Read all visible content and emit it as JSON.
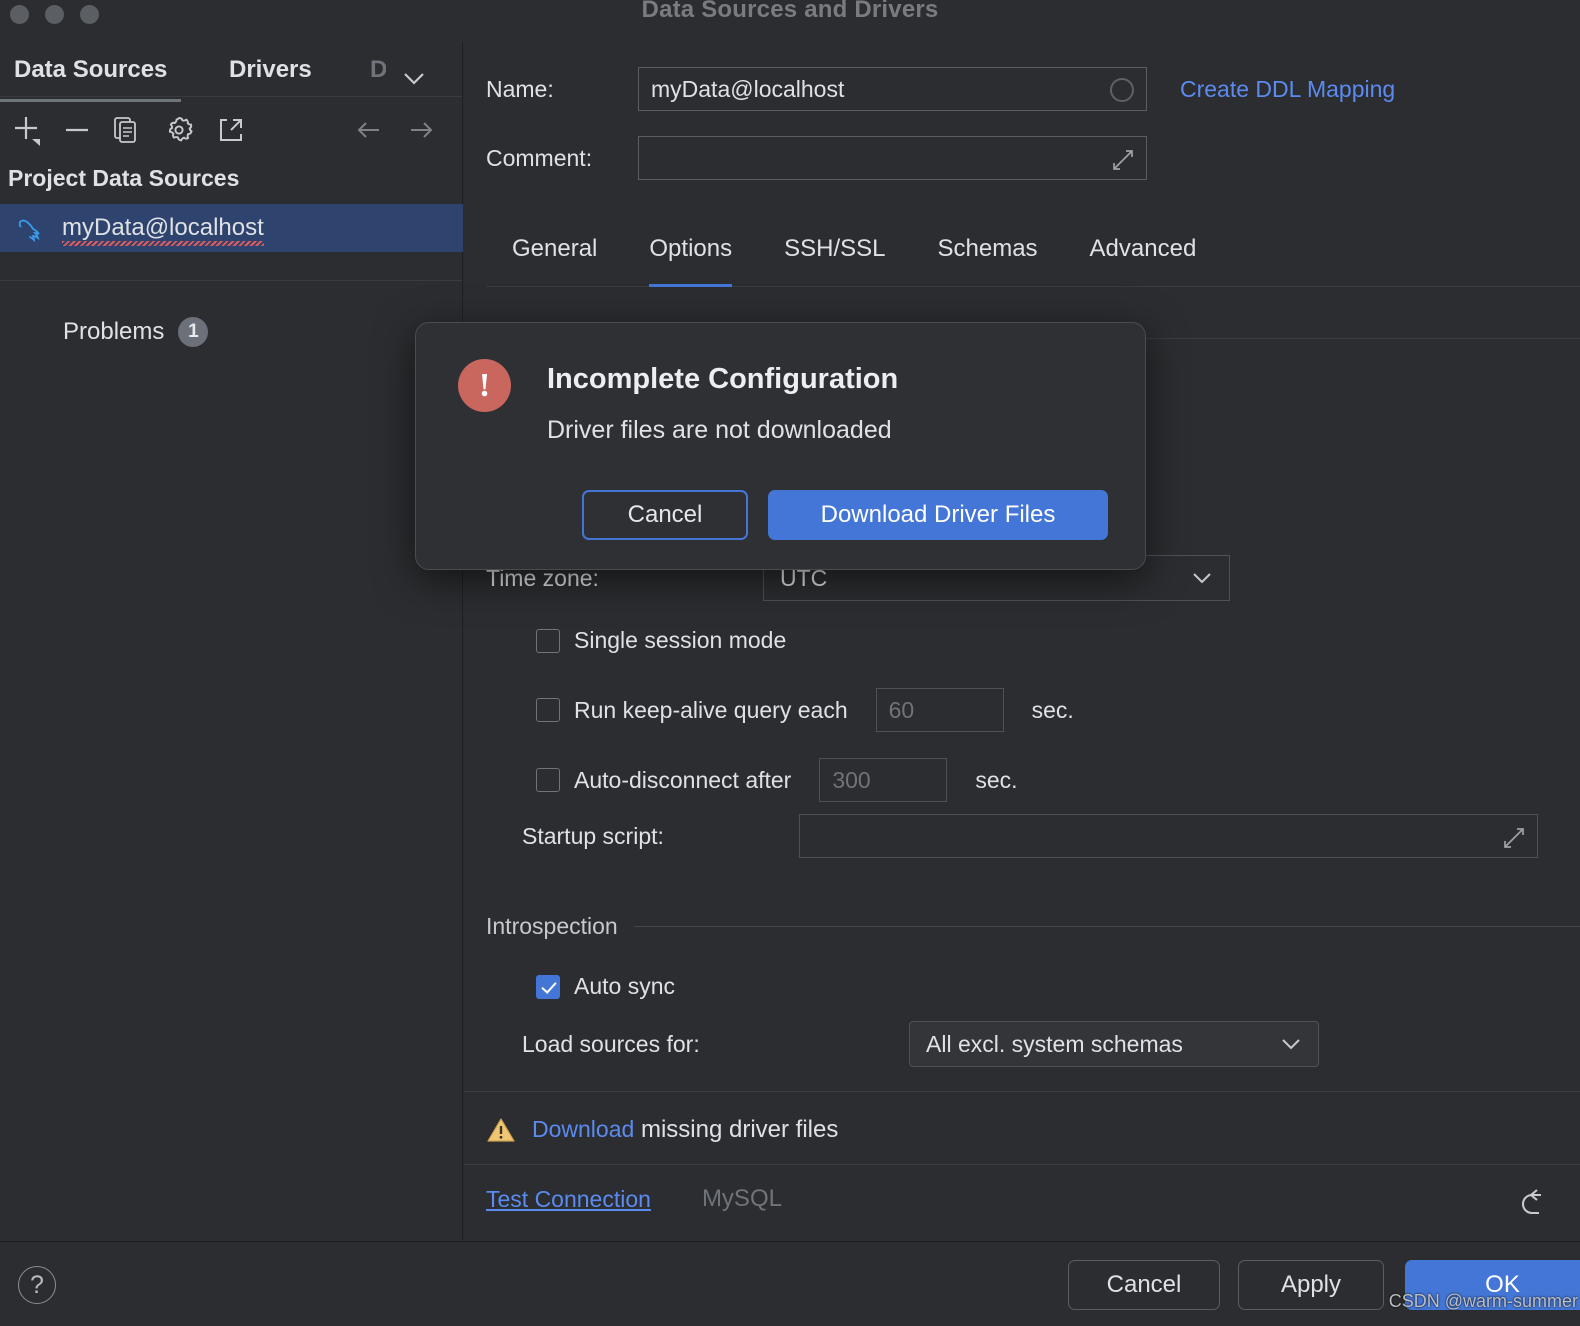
{
  "window": {
    "title": "Data Sources and Drivers"
  },
  "sidebar": {
    "tabs": [
      {
        "label": "Data Sources",
        "active": true
      },
      {
        "label": "Drivers",
        "active": false
      },
      {
        "label": "D",
        "active": false
      }
    ],
    "toolbar": [
      {
        "name": "add-icon",
        "tooltip": "Add"
      },
      {
        "name": "remove-icon",
        "tooltip": "Remove"
      },
      {
        "name": "duplicate-icon",
        "tooltip": "Duplicate"
      },
      {
        "name": "settings-gear-icon",
        "tooltip": "Settings"
      },
      {
        "name": "share-export-icon",
        "tooltip": "Export"
      },
      {
        "name": "arrow-left-icon",
        "tooltip": "Back"
      },
      {
        "name": "arrow-right-icon",
        "tooltip": "Forward"
      }
    ],
    "group_title": "Project Data Sources",
    "data_sources": [
      {
        "label": "myData@localhost",
        "icon": "mysql-dolphin-icon",
        "selected": true,
        "misspelled": true
      }
    ],
    "problems": {
      "label": "Problems",
      "count": "1"
    }
  },
  "main": {
    "name_label": "Name:",
    "name_value": "myData@localhost",
    "comment_label": "Comment:",
    "comment_value": "",
    "create_ddl_link": "Create DDL Mapping",
    "tabs": [
      {
        "label": "General",
        "active": false
      },
      {
        "label": "Options",
        "active": true
      },
      {
        "label": "SSH/SSL",
        "active": false
      },
      {
        "label": "Schemas",
        "active": false
      },
      {
        "label": "Advanced",
        "active": false
      }
    ],
    "timezone_label": "Time zone:",
    "timezone_value": "UTC",
    "single_session_label": "Single session mode",
    "single_session_checked": false,
    "keepalive_label": "Run keep-alive query each",
    "keepalive_checked": false,
    "keepalive_placeholder": "60",
    "keepalive_unit": "sec.",
    "autodisconnect_label": "Auto-disconnect after",
    "autodisconnect_checked": false,
    "autodisconnect_placeholder": "300",
    "autodisconnect_unit": "sec.",
    "startup_script_label": "Startup script:",
    "startup_script_value": "",
    "introspection_group": "Introspection",
    "auto_sync_label": "Auto sync",
    "auto_sync_checked": true,
    "load_sources_label": "Load sources for:",
    "load_sources_value": "All excl. system schemas",
    "warning_link": "Download",
    "warning_rest": " missing driver files",
    "test_connection": "Test Connection",
    "driver_name": "MySQL"
  },
  "modal": {
    "icon": "error-exclamation-icon",
    "title": "Incomplete Configuration",
    "message": "Driver files are not downloaded",
    "cancel_label": "Cancel",
    "download_label": "Download Driver Files"
  },
  "footer": {
    "help_label": "?",
    "cancel_label": "Cancel",
    "apply_label": "Apply",
    "ok_label": "OK",
    "watermark": "CSDN @warm-summer"
  },
  "colors": {
    "accent_blue": "#4376d6",
    "link_blue": "#5b8bf0",
    "error_red": "#c9675f",
    "warning_yellow": "#f0c674",
    "selection_navy": "#2e436e",
    "background": "#2b2d30"
  }
}
